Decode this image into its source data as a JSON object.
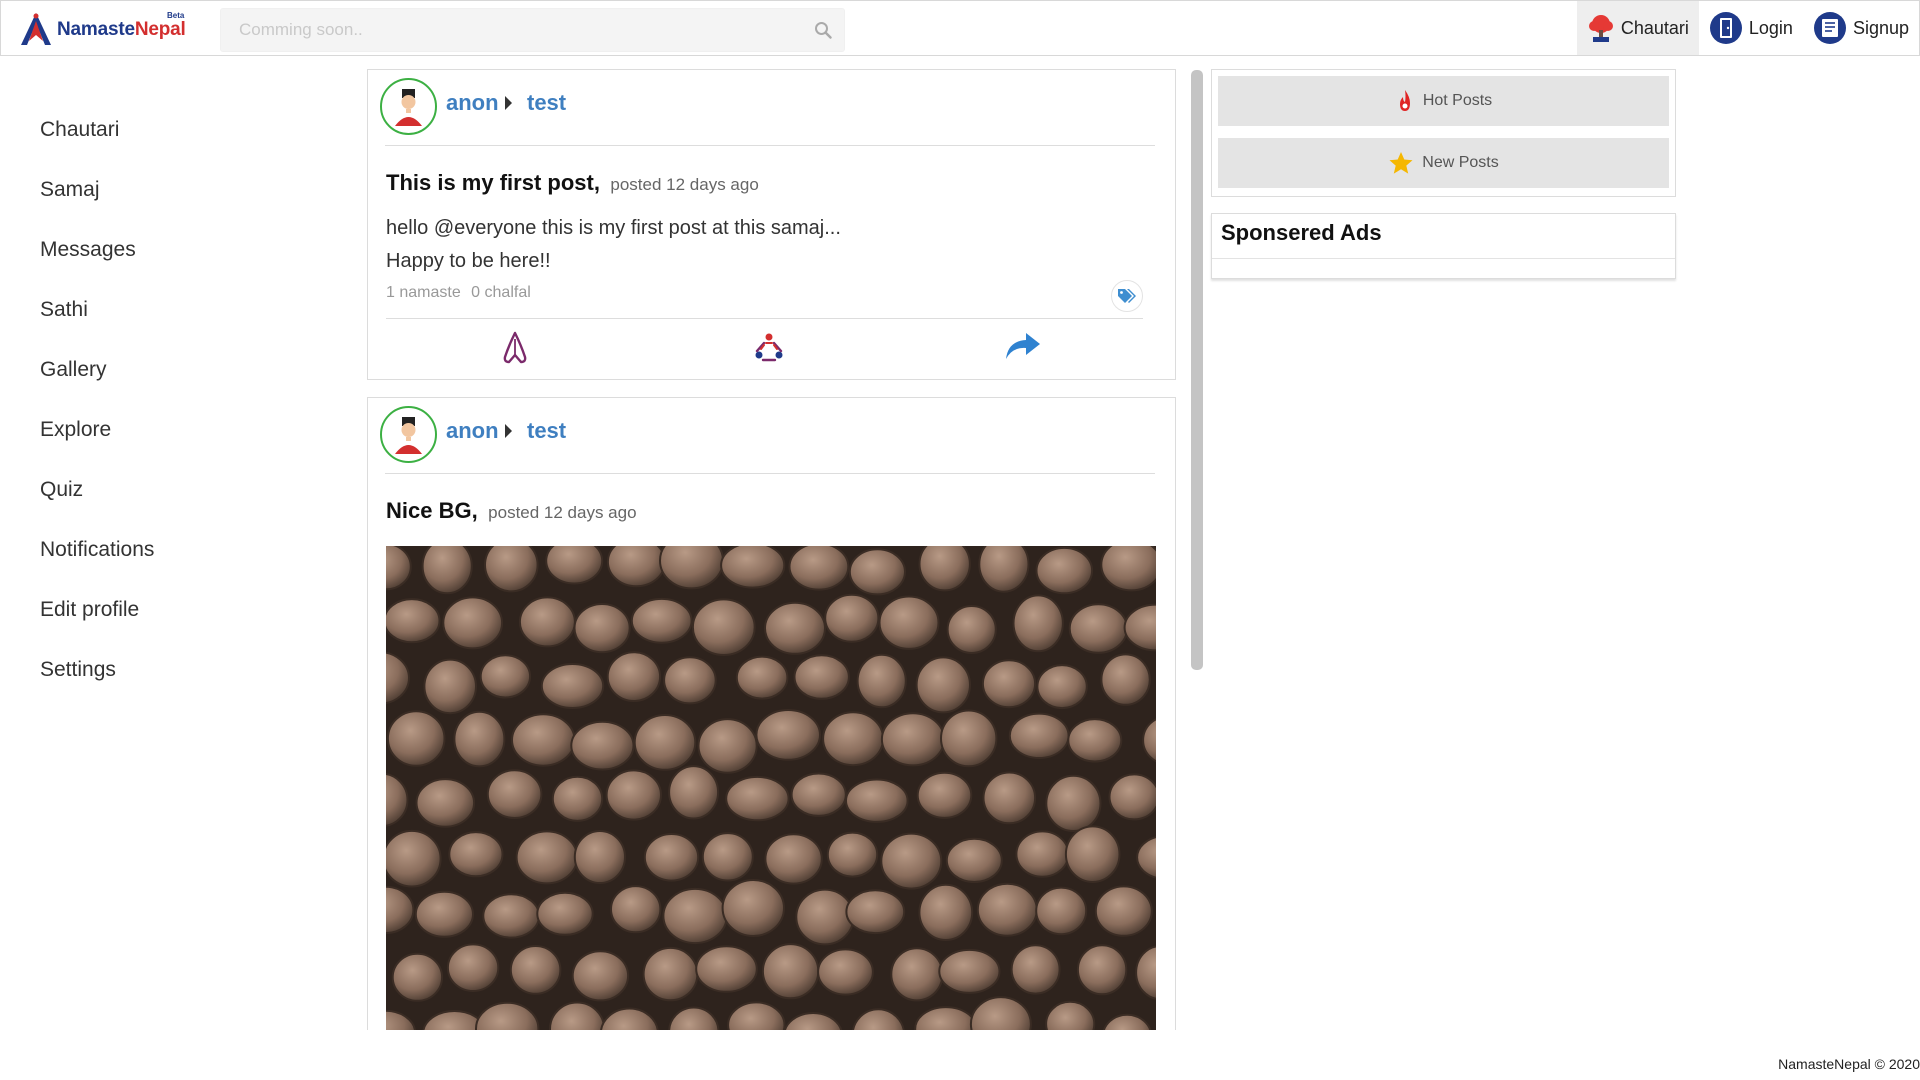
{
  "brand": {
    "name_part1": "Namaste",
    "name_part2": "Nepal",
    "badge": "Beta"
  },
  "search": {
    "placeholder": "Comming soon.."
  },
  "nav": {
    "chautari": "Chautari",
    "login": "Login",
    "signup": "Signup"
  },
  "sidebar": {
    "items": [
      {
        "label": "Chautari"
      },
      {
        "label": "Samaj"
      },
      {
        "label": "Messages"
      },
      {
        "label": "Sathi"
      },
      {
        "label": "Gallery"
      },
      {
        "label": "Explore"
      },
      {
        "label": "Quiz"
      },
      {
        "label": "Notifications"
      },
      {
        "label": "Edit profile"
      },
      {
        "label": "Settings"
      }
    ]
  },
  "posts": [
    {
      "user": "anon",
      "group": "test",
      "title": "This is my first post,",
      "meta": "posted 12 days ago",
      "body_line1": "hello @everyone this is my first post at this samaj...",
      "body_line2": "Happy to be here!!",
      "namaste": "1 namaste",
      "chalfal": "0 chalfal"
    },
    {
      "user": "anon",
      "group": "test",
      "title": "Nice BG,",
      "meta": "posted 12 days ago"
    }
  ],
  "right": {
    "hot_posts": "Hot Posts",
    "new_posts": "New Posts",
    "ads_title": "Sponsered Ads"
  },
  "footer": {
    "copyright": "NamasteNepal © 2020"
  },
  "colors": {
    "brand_blue": "#1f3a8a",
    "brand_red": "#d32f2f",
    "link_blue": "#3f7fc0",
    "avatar_border": "#3cb043"
  }
}
